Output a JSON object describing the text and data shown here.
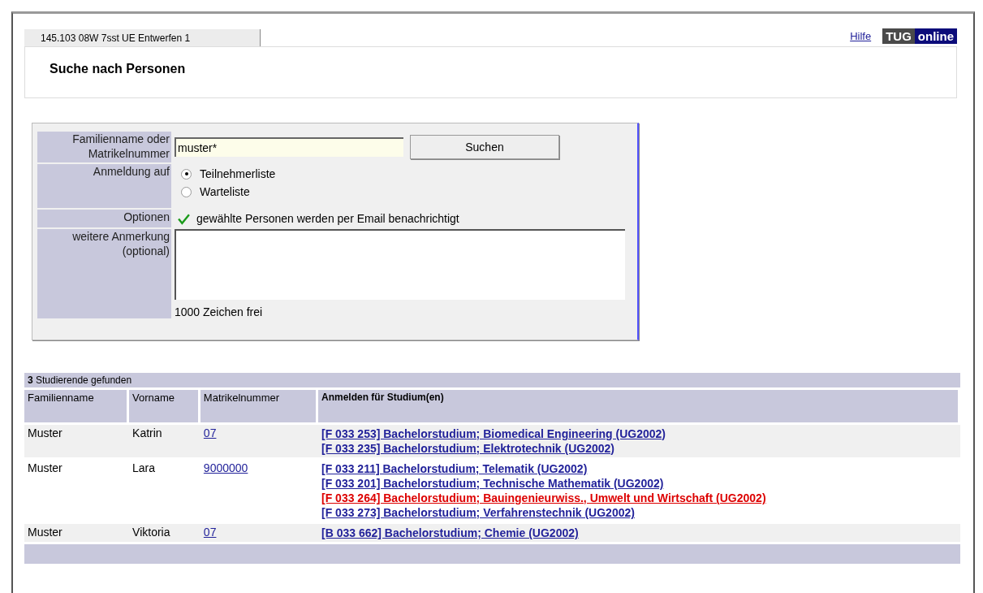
{
  "tab": {
    "label": "145.103 08W 7sst UE Entwerfen 1",
    "selected": true
  },
  "header": {
    "help_link": "Hilfe",
    "logo": [
      "TUG",
      "online"
    ],
    "title": "Suche nach Personen"
  },
  "form": {
    "search_label": "Familienname oder Matrikelnummer",
    "search_value": "muster*",
    "search_button": "Suchen",
    "registration_label": "Anmeldung auf",
    "registration_options": [
      {
        "label": "Teilnehmerliste",
        "selected": true
      },
      {
        "label": "Warteliste",
        "selected": false
      }
    ],
    "options_label": "Optionen",
    "notify_option": {
      "label": "gewählte Personen werden per Email benachrichtigt",
      "checked": true
    },
    "remark_label": "weitere Anmerkung (optional)",
    "remark_counter": "1000 Zeichen frei"
  },
  "results": {
    "count": "3",
    "summary": "Studierende gefunden",
    "columns": [
      "Familienname",
      "Vorname",
      "Matrikelnummer",
      "Anmelden für Studium(en)"
    ],
    "rows": [
      {
        "last_name": "Muster",
        "first_name": "Katrin",
        "matriculation": "07",
        "programs": [
          {
            "label": "[F 033 253] Bachelorstudium; Biomedical Engineering (UG2002)",
            "highlighted": false
          },
          {
            "label": "[F 033 235] Bachelorstudium; Elektrotechnik (UG2002)",
            "highlighted": false
          }
        ]
      },
      {
        "last_name": "Muster",
        "first_name": "Lara",
        "matriculation": "9000000",
        "programs": [
          {
            "label": "[F 033 211] Bachelorstudium; Telematik (UG2002)",
            "highlighted": false
          },
          {
            "label": "[F 033 201] Bachelorstudium; Technische Mathematik (UG2002)",
            "highlighted": false
          },
          {
            "label": "[F 033 264] Bachelorstudium; Bauingenieurwiss., Umwelt und Wirtschaft (UG2002)",
            "highlighted": true
          },
          {
            "label": "[F 033 273] Bachelorstudium; Verfahrenstechnik (UG2002)",
            "highlighted": false
          }
        ]
      },
      {
        "last_name": "Muster",
        "first_name": "Viktoria",
        "matriculation": "07",
        "programs": [
          {
            "label": "[B 033 662] Bachelorstudium; Chemie (UG2002)",
            "highlighted": false
          }
        ]
      }
    ]
  }
}
